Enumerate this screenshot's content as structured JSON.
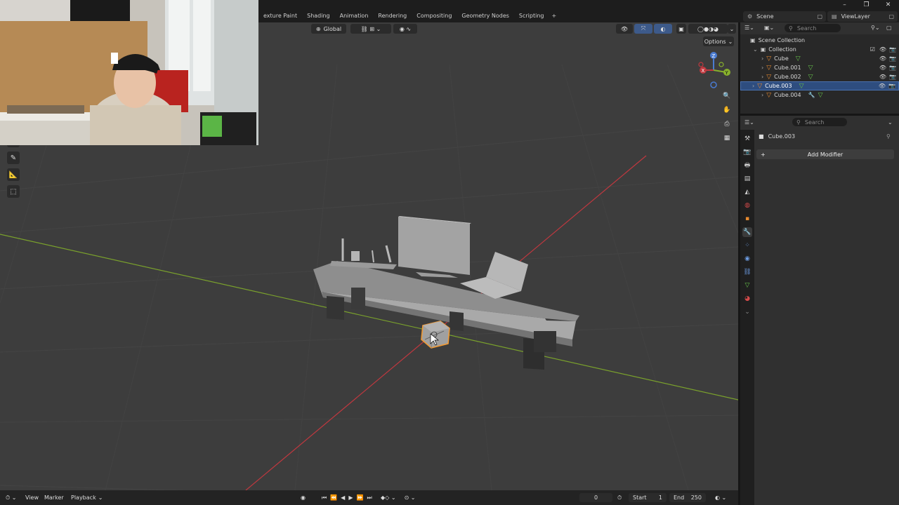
{
  "topbar": {
    "tabs": [
      "exture Paint",
      "Shading",
      "Animation",
      "Rendering",
      "Compositing",
      "Geometry Nodes",
      "Scripting"
    ],
    "add_tab": "+",
    "scene": "Scene",
    "view_layer": "ViewLayer",
    "window_controls": [
      "–",
      "❐",
      "✕"
    ]
  },
  "viewport_header": {
    "orientation": "Global",
    "options": "Options"
  },
  "outliner": {
    "search_placeholder": "Search",
    "root": "Scene Collection",
    "collection": "Collection",
    "items": [
      {
        "name": "Cube",
        "selected": false
      },
      {
        "name": "Cube.001",
        "selected": false
      },
      {
        "name": "Cube.002",
        "selected": false
      },
      {
        "name": "Cube.003",
        "selected": true
      },
      {
        "name": "Cube.004",
        "selected": false
      }
    ]
  },
  "properties": {
    "search_placeholder": "Search",
    "object_name": "Cube.003",
    "add_modifier": "Add Modifier",
    "add_icon": "+"
  },
  "timeline": {
    "view": "View",
    "marker": "Marker",
    "playback": "Playback",
    "current_frame": "0",
    "start_label": "Start",
    "start": "1",
    "end_label": "End",
    "end": "250"
  },
  "colors": {
    "accent_selected": "#2e4d7f",
    "object_orange": "#e88a2f",
    "mesh_green": "#67c24b",
    "x_axis": "#c0383f",
    "y_axis": "#7aa12c"
  }
}
